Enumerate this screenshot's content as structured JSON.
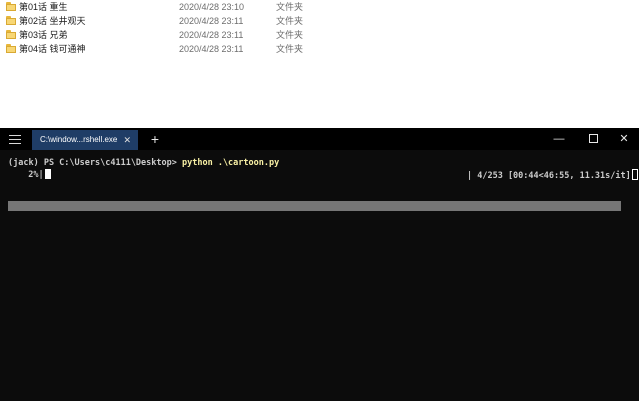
{
  "explorer": {
    "folders": [
      {
        "name": "第01话 重生",
        "date": "2020/4/28 23:10",
        "type": "文件夹"
      },
      {
        "name": "第02话 坐井观天",
        "date": "2020/4/28 23:11",
        "type": "文件夹"
      },
      {
        "name": "第03话 兄弟",
        "date": "2020/4/28 23:11",
        "type": "文件夹"
      },
      {
        "name": "第04话 钱可通神",
        "date": "2020/4/28 23:11",
        "type": "文件夹"
      }
    ]
  },
  "terminal": {
    "tab_title": "C:\\window...rshell.exe",
    "tab_close": "✕",
    "new_tab": "+",
    "minimize": "—",
    "close": "✕",
    "prompt": "(jack) PS C:\\Users\\c4111\\Desktop> ",
    "command": "python .\\cartoon.py",
    "progress_percent": "  2%|",
    "progress_fraction": 0.02,
    "progress_stats": "| 4/253 [00:44<46:55, 11.31s/it]"
  },
  "icons": [
    "hamburger-menu-icon",
    "folder-icon",
    "minimize-icon",
    "maximize-icon",
    "close-icon",
    "plus-icon"
  ]
}
